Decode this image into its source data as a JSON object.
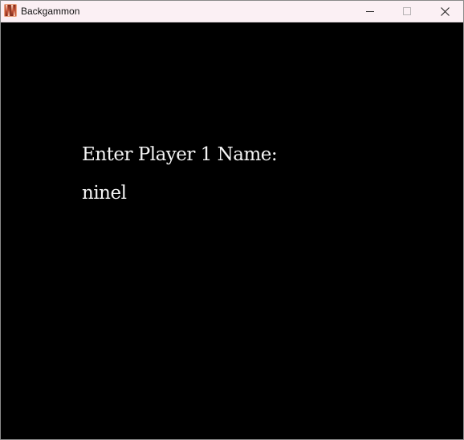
{
  "window": {
    "title": "Backgammon",
    "icon": "backgammon-app-icon",
    "controls": [
      "minimize-icon",
      "maximize-icon",
      "close-icon"
    ]
  },
  "screen": {
    "prompt": "Enter Player 1 Name:",
    "name_value": "ninel",
    "background_color": "#000000",
    "text_color": "#f4f4f4"
  }
}
